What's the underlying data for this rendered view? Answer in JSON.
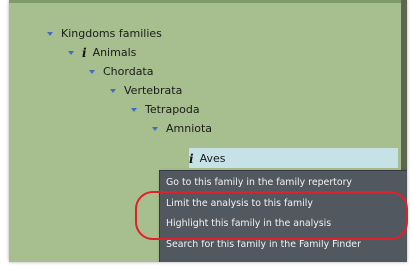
{
  "tree": {
    "items": [
      {
        "label": "Kingdoms families",
        "info": false
      },
      {
        "label": "Animals",
        "info": true
      },
      {
        "label": "Chordata",
        "info": false
      },
      {
        "label": "Vertebrata",
        "info": false
      },
      {
        "label": "Tetrapoda",
        "info": false
      },
      {
        "label": "Amniota",
        "info": false
      },
      {
        "label": "Aves",
        "info": true,
        "selected": true
      }
    ],
    "info_glyph": "i"
  },
  "context_menu": {
    "items": [
      "Go to this family in the family repertory",
      "Limit the analysis to this family",
      "Highlight this family in the analysis",
      "Search for this family in the Family Finder"
    ]
  },
  "colors": {
    "panel_background": "#a7be8f",
    "selection": "#c7e2e7",
    "menu_background": "#52585f",
    "caret": "#3f6ec2",
    "annotation_ring": "#e0202a"
  }
}
